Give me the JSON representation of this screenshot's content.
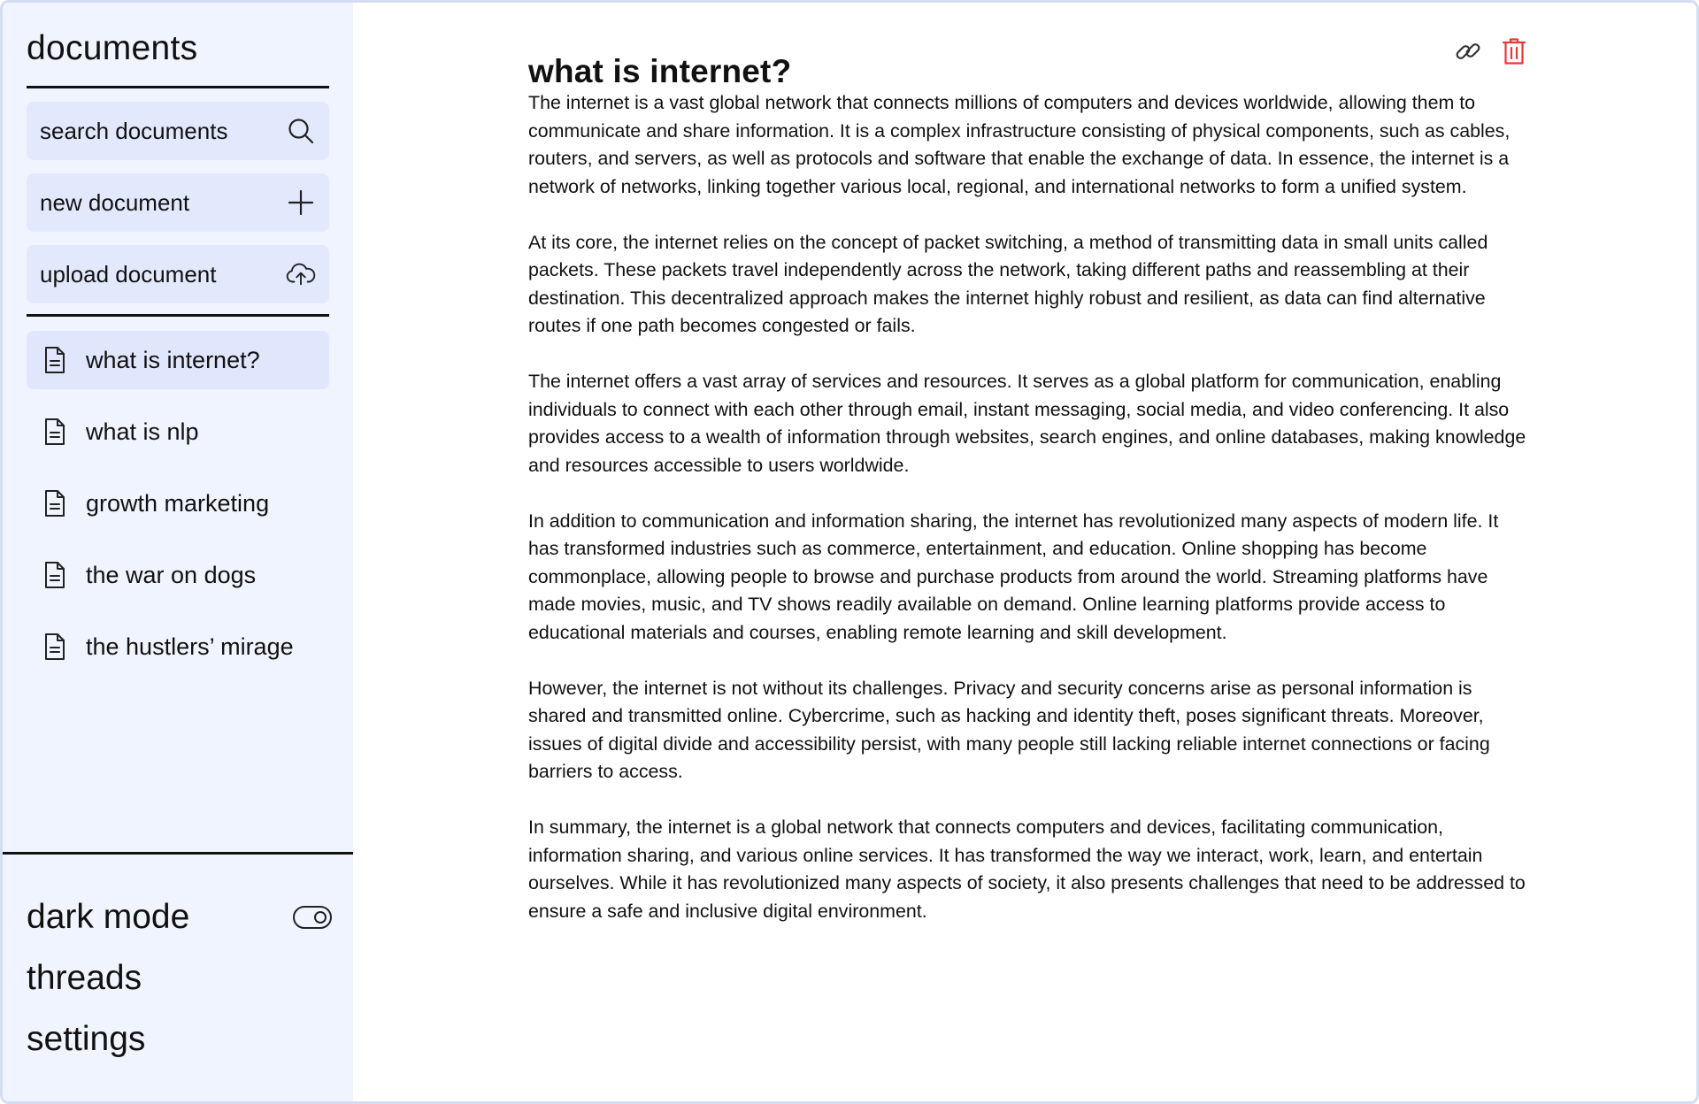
{
  "sidebar": {
    "title": "documents",
    "actions": [
      {
        "label": "search documents",
        "icon": "search-icon"
      },
      {
        "label": "new document",
        "icon": "plus-icon"
      },
      {
        "label": "upload document",
        "icon": "cloud-upload-icon"
      }
    ],
    "documents": [
      {
        "label": "what is internet?",
        "active": true
      },
      {
        "label": "what is nlp",
        "active": false
      },
      {
        "label": "growth marketing",
        "active": false
      },
      {
        "label": "the war on dogs",
        "active": false
      },
      {
        "label": "the hustlers’ mirage",
        "active": false
      }
    ],
    "bottom": {
      "dark_mode": "dark mode",
      "dark_mode_on": false,
      "threads": "threads",
      "settings": "settings"
    }
  },
  "main": {
    "title": "what is internet?",
    "paragraphs": [
      "The internet is a vast global network that connects millions of computers and devices worldwide, allowing them to communicate and share information. It is a complex infrastructure consisting of physical components, such as cables, routers, and servers, as well as protocols and software that enable the exchange of data. In essence, the internet is a network of networks, linking together various local, regional, and international networks to form a unified system.",
      "At its core, the internet relies on the concept of packet switching, a method of transmitting data in small units called packets. These packets travel independently across the network, taking different paths and reassembling at their destination. This decentralized approach makes the internet highly robust and resilient, as data can find alternative routes if one path becomes congested or fails.",
      "The internet offers a vast array of services and resources. It serves as a global platform for communication, enabling individuals to connect with each other through email, instant messaging, social media, and video conferencing. It also provides access to a wealth of information through websites, search engines, and online databases, making knowledge and resources accessible to users worldwide.",
      "In addition to communication and information sharing, the internet has revolutionized many aspects of modern life. It has transformed industries such as commerce, entertainment, and education. Online shopping has become commonplace, allowing people to browse and purchase products from around the world. Streaming platforms have made movies, music, and TV shows readily available on demand. Online learning platforms provide access to educational materials and courses, enabling remote learning and skill development.",
      "However, the internet is not without its challenges. Privacy and security concerns arise as personal information is shared and transmitted online. Cybercrime, such as hacking and identity theft, poses significant threats. Moreover, issues of digital divide and accessibility persist, with many people still lacking reliable internet connections or facing barriers to access.",
      "In summary, the internet is a global network that connects computers and devices, facilitating communication, information sharing, and various online services. It has transformed the way we interact, work, learn, and entertain ourselves. While it has revolutionized many aspects of society, it also presents challenges that need to be addressed to ensure a safe and inclusive digital environment."
    ],
    "icons": [
      "link-icon",
      "trash-icon"
    ]
  },
  "colors": {
    "sidebar_bg": "#f0f4fe",
    "button_bg": "#e3e9fd",
    "active_item_bg": "#e0e7fd",
    "delete_red": "#e53935",
    "border": "#d4dcf2"
  }
}
